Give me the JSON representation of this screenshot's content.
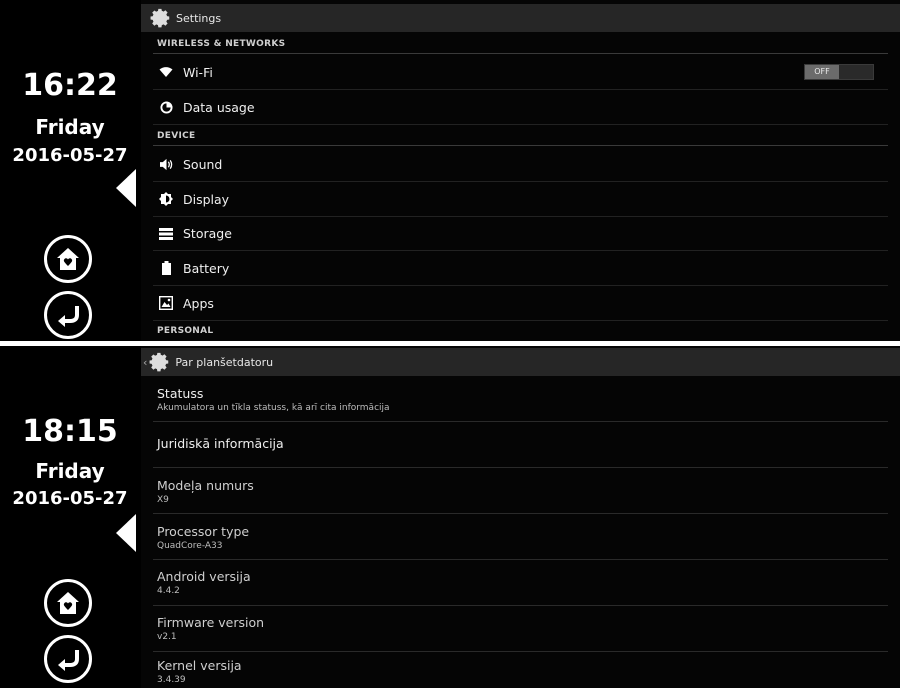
{
  "screen1": {
    "clock": {
      "time": "16:22",
      "day": "Friday",
      "date": "2016-05-27"
    },
    "header": {
      "title": "Settings",
      "icon": "gear-icon"
    },
    "sections": {
      "wireless": "WIRELESS & NETWORKS",
      "device": "DEVICE",
      "personal": "PERSONAL"
    },
    "items": {
      "wifi": {
        "label": "Wi-Fi",
        "toggle": "OFF",
        "icon": "wifi-icon"
      },
      "data_usage": {
        "label": "Data usage",
        "icon": "data-usage-icon"
      },
      "sound": {
        "label": "Sound",
        "icon": "speaker-icon"
      },
      "display": {
        "label": "Display",
        "icon": "brightness-icon"
      },
      "storage": {
        "label": "Storage",
        "icon": "storage-icon"
      },
      "battery": {
        "label": "Battery",
        "icon": "battery-icon"
      },
      "apps": {
        "label": "Apps",
        "icon": "apps-icon"
      }
    }
  },
  "screen2": {
    "clock": {
      "time": "18:15",
      "day": "Friday",
      "date": "2016-05-27"
    },
    "header": {
      "title": "Par planšetdatoru",
      "icon": "gear-icon",
      "back": "chevron-left-icon"
    },
    "items": [
      {
        "title": "Statuss",
        "subtitle": "Akumulatora un tīkla statuss, kā arī cita informācija"
      },
      {
        "title": "Juridiskā informācija",
        "subtitle": ""
      },
      {
        "title": "Modeļa numurs",
        "subtitle": "X9"
      },
      {
        "title": "Processor type",
        "subtitle": "QuadCore-A33"
      },
      {
        "title": "Android versija",
        "subtitle": "4.4.2"
      },
      {
        "title": "Firmware version",
        "subtitle": "v2.1"
      },
      {
        "title": "Kernel versija",
        "subtitle": "3.4.39"
      }
    ]
  },
  "colors": {
    "background": "#000000",
    "header_bar": "#262626",
    "divider": "#3a3a3a",
    "text": "#f0f0f0"
  }
}
